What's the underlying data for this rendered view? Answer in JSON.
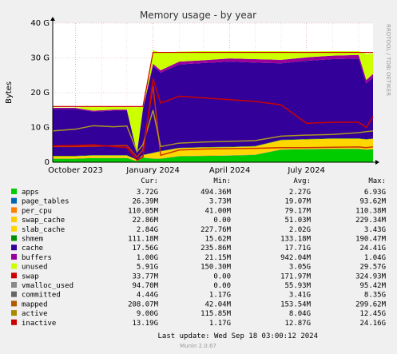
{
  "chart_data": {
    "type": "area",
    "title": "Memory usage - by year",
    "ylabel": "Bytes",
    "watermark": "RRDTOOL / TOBI OETIKER",
    "ylim": [
      0,
      40
    ],
    "yticks": [
      {
        "v": 0,
        "label": "0"
      },
      {
        "v": 10,
        "label": "10 G"
      },
      {
        "v": 20,
        "label": "20 G"
      },
      {
        "v": 30,
        "label": "30 G"
      },
      {
        "v": 40,
        "label": "40 G"
      }
    ],
    "xlim": [
      "2023-09-04",
      "2024-09-18"
    ],
    "xticks": [
      {
        "date": "2023-10-01",
        "label": "October 2023"
      },
      {
        "date": "2024-01-01",
        "label": "January 2024"
      },
      {
        "date": "2024-04-01",
        "label": "April 2024"
      },
      {
        "date": "2024-07-01",
        "label": "July 2024"
      }
    ],
    "x": [
      "2023-09-04",
      "2023-10-01",
      "2023-10-22",
      "2023-11-15",
      "2023-12-01",
      "2023-12-13",
      "2023-12-20",
      "2024-01-01",
      "2024-01-10",
      "2024-02-01",
      "2024-03-01",
      "2024-04-01",
      "2024-05-01",
      "2024-06-01",
      "2024-07-01",
      "2024-08-01",
      "2024-09-01",
      "2024-09-10",
      "2024-09-18"
    ],
    "stack": [
      {
        "name": "apps",
        "color": "#00cc00",
        "values": [
          1.0,
          1.0,
          1.2,
          1.2,
          1.2,
          0.3,
          1.3,
          1.0,
          1.0,
          1.7,
          1.8,
          1.9,
          2.1,
          3.6,
          3.7,
          3.8,
          3.8,
          3.6,
          3.72
        ]
      },
      {
        "name": "page_tables",
        "color": "#0066b3",
        "values": [
          0.02,
          0.02,
          0.02,
          0.02,
          0.02,
          0.01,
          0.02,
          0.02,
          0.02,
          0.02,
          0.02,
          0.02,
          0.02,
          0.03,
          0.03,
          0.03,
          0.03,
          0.03,
          0.03
        ]
      },
      {
        "name": "per_cpu",
        "color": "#ff8000",
        "values": [
          0.1,
          0.1,
          0.1,
          0.1,
          0.1,
          0.05,
          0.1,
          0.1,
          0.1,
          0.1,
          0.1,
          0.1,
          0.1,
          0.1,
          0.1,
          0.1,
          0.1,
          0.1,
          0.11
        ]
      },
      {
        "name": "swap_cache",
        "color": "#ffcc00",
        "values": [
          0.01,
          0.01,
          0.01,
          0.01,
          0.01,
          0.0,
          0.01,
          0.02,
          0.02,
          0.02,
          0.02,
          0.03,
          0.03,
          0.03,
          0.03,
          0.03,
          0.03,
          0.02,
          0.02
        ]
      },
      {
        "name": "slab_cache",
        "color": "#ffd700",
        "values": [
          0.6,
          0.6,
          0.6,
          0.6,
          0.6,
          0.3,
          0.6,
          1.5,
          2.0,
          2.2,
          2.3,
          2.3,
          2.3,
          2.6,
          2.7,
          2.8,
          2.8,
          2.8,
          2.84
        ]
      },
      {
        "name": "shmem",
        "color": "#008f00",
        "values": [
          0.1,
          0.1,
          0.1,
          0.1,
          0.1,
          0.05,
          0.1,
          0.1,
          0.1,
          0.1,
          0.1,
          0.1,
          0.1,
          0.1,
          0.1,
          0.1,
          0.1,
          0.1,
          0.11
        ]
      },
      {
        "name": "cache",
        "color": "#330099",
        "values": [
          13.5,
          13.5,
          12.5,
          12.8,
          12.8,
          2.0,
          13.0,
          25.0,
          22.5,
          24.0,
          24.2,
          24.5,
          24.0,
          22.0,
          22.5,
          22.8,
          23.0,
          16.0,
          17.56
        ]
      },
      {
        "name": "buffers",
        "color": "#990099",
        "values": [
          0.3,
          0.3,
          0.3,
          0.3,
          0.3,
          0.1,
          0.3,
          0.6,
          0.7,
          0.8,
          0.8,
          0.9,
          1.0,
          1.0,
          1.0,
          1.0,
          1.0,
          1.0,
          1.0
        ]
      },
      {
        "name": "unused",
        "color": "#ccff00",
        "values": [
          0.1,
          0.1,
          1.2,
          0.8,
          0.8,
          13.0,
          0.5,
          4.0,
          5.0,
          2.9,
          2.6,
          2.1,
          2.3,
          2.5,
          1.7,
          1.3,
          1.1,
          7.5,
          5.91
        ]
      }
    ],
    "lines": [
      {
        "name": "committed",
        "color": "#cc3300",
        "values": [
          4.5,
          4.5,
          4.6,
          4.7,
          4.8,
          1.5,
          3.5,
          22.0,
          2.0,
          3.5,
          3.8,
          3.9,
          4.0,
          4.2,
          4.2,
          4.3,
          4.4,
          4.2,
          4.44
        ]
      },
      {
        "name": "active",
        "color": "#aa9922",
        "values": [
          9.0,
          9.5,
          10.5,
          10.2,
          10.4,
          3.0,
          5.0,
          15.0,
          4.5,
          5.5,
          5.8,
          6.0,
          6.2,
          7.5,
          7.8,
          8.0,
          8.5,
          8.8,
          9.0
        ]
      },
      {
        "name": "inactive",
        "color": "#cc0000",
        "values": [
          4.7,
          4.8,
          5.0,
          4.5,
          4.2,
          0.6,
          1.5,
          24.0,
          17.0,
          19.0,
          18.5,
          18.0,
          17.5,
          16.5,
          11.2,
          11.5,
          11.5,
          10.0,
          13.19
        ]
      }
    ],
    "max_line": {
      "color": "#cc0000",
      "values": [
        16.0,
        16.0,
        16.0,
        16.0,
        16.0,
        16.0,
        16.0,
        31.6,
        31.6,
        31.6,
        31.6,
        31.6,
        31.6,
        31.6,
        31.6,
        31.6,
        31.6,
        31.6,
        31.6
      ]
    }
  },
  "legend": {
    "headers": [
      "Cur:",
      "Min:",
      "Avg:",
      "Max:"
    ],
    "rows": [
      {
        "name": "apps",
        "color": "#00cc00",
        "cur": "3.72G",
        "min": "494.36M",
        "avg": "2.27G",
        "max": "6.93G"
      },
      {
        "name": "page_tables",
        "color": "#0066b3",
        "cur": "26.39M",
        "min": "3.73M",
        "avg": "19.07M",
        "max": "93.62M"
      },
      {
        "name": "per_cpu",
        "color": "#ff8000",
        "cur": "110.05M",
        "min": "41.00M",
        "avg": "79.17M",
        "max": "110.38M"
      },
      {
        "name": "swap_cache",
        "color": "#ffcc00",
        "cur": "22.86M",
        "min": "0.00",
        "avg": "51.03M",
        "max": "229.34M"
      },
      {
        "name": "slab_cache",
        "color": "#ffd700",
        "cur": "2.84G",
        "min": "227.76M",
        "avg": "2.02G",
        "max": "3.43G"
      },
      {
        "name": "shmem",
        "color": "#008f00",
        "cur": "111.18M",
        "min": "15.62M",
        "avg": "133.18M",
        "max": "190.47M"
      },
      {
        "name": "cache",
        "color": "#330099",
        "cur": "17.56G",
        "min": "235.86M",
        "avg": "17.71G",
        "max": "24.41G"
      },
      {
        "name": "buffers",
        "color": "#990099",
        "cur": "1.00G",
        "min": "21.15M",
        "avg": "942.04M",
        "max": "1.04G"
      },
      {
        "name": "unused",
        "color": "#ccff00",
        "cur": "5.91G",
        "min": "150.30M",
        "avg": "3.05G",
        "max": "29.57G"
      },
      {
        "name": "swap",
        "color": "#cc0000",
        "cur": "33.77M",
        "min": "0.00",
        "avg": "171.97M",
        "max": "324.93M"
      },
      {
        "name": "vmalloc_used",
        "color": "#888888",
        "cur": "94.70M",
        "min": "0.00",
        "avg": "55.93M",
        "max": "95.42M"
      },
      {
        "name": "committed",
        "color": "#666666",
        "cur": "4.44G",
        "min": "1.17G",
        "avg": "3.41G",
        "max": "8.35G"
      },
      {
        "name": "mapped",
        "color": "#b35900",
        "cur": "208.07M",
        "min": "42.04M",
        "avg": "153.54M",
        "max": "299.62M"
      },
      {
        "name": "active",
        "color": "#aa8800",
        "cur": "9.00G",
        "min": "115.85M",
        "avg": "8.04G",
        "max": "12.45G"
      },
      {
        "name": "inactive",
        "color": "#cc0000",
        "cur": "13.19G",
        "min": "1.17G",
        "avg": "12.87G",
        "max": "24.16G"
      }
    ]
  },
  "footer": {
    "last_update": "Last update: Wed Sep 18 03:00:12 2024",
    "munin": "Munin 2.0.67"
  }
}
